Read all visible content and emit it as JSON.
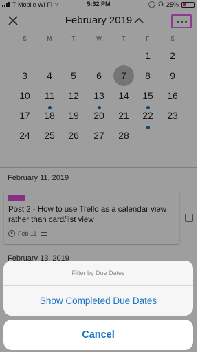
{
  "status_bar": {
    "carrier": "T-Mobile Wi-Fi",
    "time": "5:32 PM",
    "battery": "25%"
  },
  "header": {
    "title": "February 2019",
    "close_icon": "close-icon",
    "collapse_icon": "chevron-up-icon",
    "more_icon": "more-icon"
  },
  "calendar": {
    "weekdays": [
      "S",
      "M",
      "T",
      "W",
      "T",
      "F",
      "S"
    ],
    "weeks": [
      [
        "",
        "",
        "",
        "",
        "",
        "1",
        "2"
      ],
      [
        "3",
        "4",
        "5",
        "6",
        "7",
        "8",
        "9"
      ],
      [
        "10",
        "11",
        "12",
        "13",
        "14",
        "15",
        "16"
      ],
      [
        "17",
        "18",
        "19",
        "20",
        "21",
        "22",
        "23"
      ],
      [
        "24",
        "25",
        "26",
        "27",
        "28",
        "",
        ""
      ]
    ],
    "today": "7",
    "days_with_cards": [
      "11",
      "13",
      "15",
      "22"
    ],
    "dot_color": "#1e6fa6"
  },
  "list": {
    "sections": [
      {
        "date": "February 11, 2019",
        "cards": [
          {
            "label_color": "#d84fd0",
            "title": "Post 2 - How to use Trello as a calendar view rather than card/list view",
            "due": "Feb 11"
          }
        ]
      },
      {
        "date": "February 13, 2019"
      }
    ]
  },
  "action_sheet": {
    "title": "Filter by Due Dates",
    "option": "Show Completed Due Dates",
    "cancel": "Cancel",
    "accent_color": "#1b74c9"
  }
}
